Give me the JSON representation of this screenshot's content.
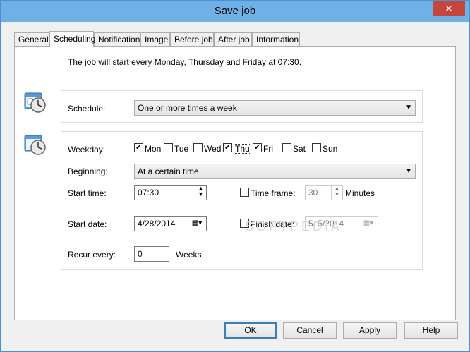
{
  "window": {
    "title": "Save job",
    "close_glyph": "✕"
  },
  "tabs": [
    {
      "label": "General"
    },
    {
      "label": "Scheduling"
    },
    {
      "label": "Notification"
    },
    {
      "label": "Image"
    },
    {
      "label": "Before job"
    },
    {
      "label": "After job"
    },
    {
      "label": "Information"
    }
  ],
  "active_tab": "Scheduling",
  "summary": "The job will start every Monday, Thursday and Friday at 07:30.",
  "schedule": {
    "label": "Schedule:",
    "value": "One or more times a week"
  },
  "weekday": {
    "label": "Weekday:",
    "days": [
      {
        "label": "Mon",
        "checked": true
      },
      {
        "label": "Tue",
        "checked": false
      },
      {
        "label": "Wed",
        "checked": false
      },
      {
        "label": "Thu",
        "checked": true
      },
      {
        "label": "Fri",
        "checked": true
      },
      {
        "label": "Sat",
        "checked": false
      },
      {
        "label": "Sun",
        "checked": false
      }
    ]
  },
  "beginning": {
    "label": "Beginning:",
    "value": "At a certain time"
  },
  "start_time": {
    "label": "Start time:",
    "value": "07:30"
  },
  "time_frame": {
    "label": "Time frame:",
    "value": "30",
    "unit": "Minutes",
    "checked": false
  },
  "start_date": {
    "label": "Start date:",
    "value": "4/28/2014"
  },
  "finish_date": {
    "label": "Finish date:",
    "value": "5/ 5/2014",
    "checked": false
  },
  "recur": {
    "label": "Recur every:",
    "value": "0",
    "unit": "Weeks"
  },
  "buttons": {
    "ok": "OK",
    "cancel": "Cancel",
    "apply": "Apply",
    "help": "Help"
  },
  "watermark": "SOFTPEDIA",
  "check_glyph": "✔",
  "colors": {
    "titlebar": "#6fb0e6",
    "close": "#c7463b",
    "default_button_border": "#3c7fb1"
  }
}
